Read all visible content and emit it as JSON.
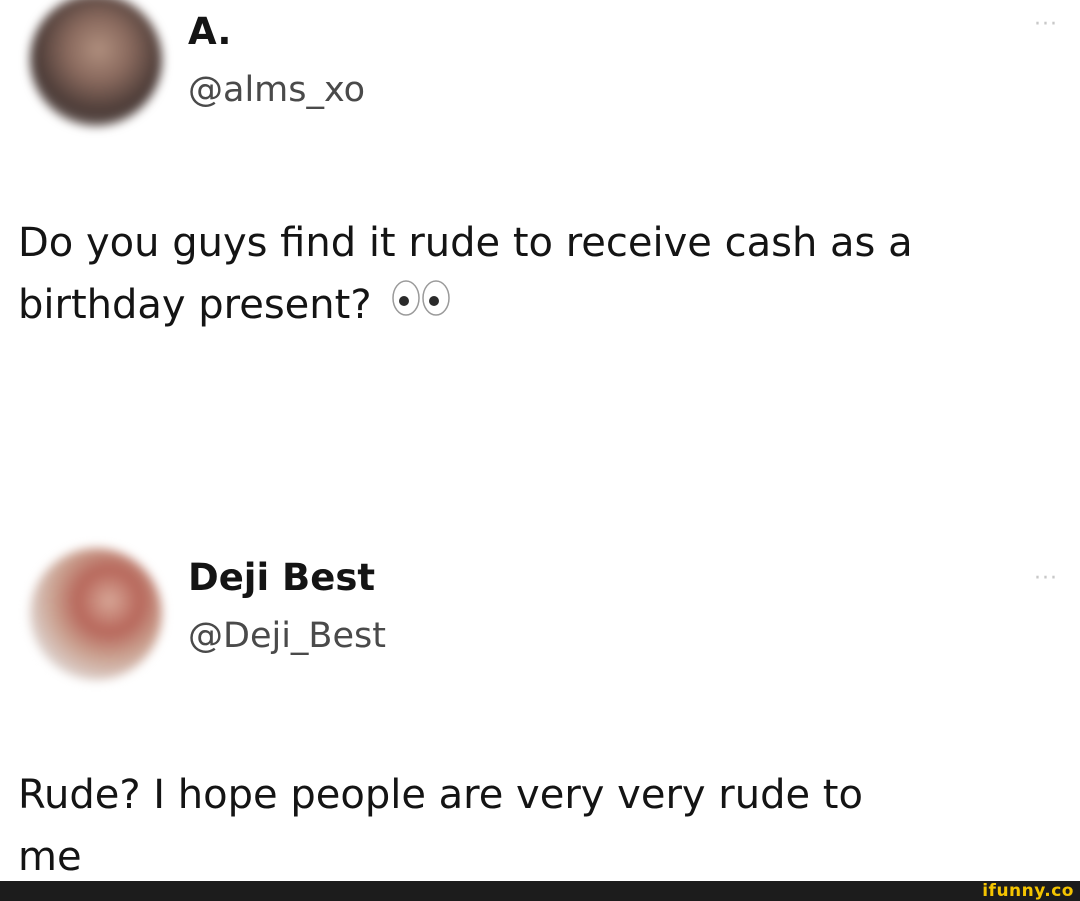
{
  "tweets": [
    {
      "name": "A.",
      "handle": "@alms_xo",
      "text": "Do you guys find it rude to receive cash as a birthday present?",
      "emoji": "eyes-emoji",
      "more": "···"
    },
    {
      "name": "Deji Best",
      "handle": "@Deji_Best",
      "text_line1": "Rude? I hope people are very very rude to",
      "text_line2": "me",
      "more": "···"
    }
  ],
  "watermark": "ifunny.co",
  "colors": {
    "background": "#ffffff",
    "text": "#141414",
    "handle": "#4a4a4a",
    "footer": "#1c1c1c",
    "watermark": "#f4c400"
  }
}
